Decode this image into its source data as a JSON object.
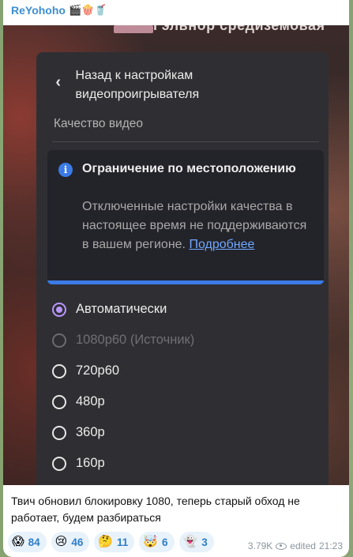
{
  "post": {
    "sender": "ReYohoho",
    "sender_emojis": "🎬🍿🥤",
    "caption": "Твич обновил блокировку 1080, теперь старый обход не работает, будем разбираться",
    "views": "3.79K",
    "edited_label": "edited",
    "time": "21:23"
  },
  "video": {
    "top_text": "Гэльнор средиземовая"
  },
  "settings": {
    "back_label": "Назад к настройкам видеопроигрывателя",
    "section_title": "Качество видео",
    "notice": {
      "icon": "info-icon",
      "title": "Ограничение по местоположению",
      "body": "Отключенные настройки качества в настоящее время не поддерживаются в вашем регионе.",
      "link": "Подробнее"
    },
    "options": [
      {
        "label": "Автоматически",
        "state": "selected"
      },
      {
        "label": "1080p60 (Источник)",
        "state": "disabled"
      },
      {
        "label": "720p60",
        "state": "available"
      },
      {
        "label": "480p",
        "state": "available"
      },
      {
        "label": "360p",
        "state": "available"
      },
      {
        "label": "160p",
        "state": "available"
      }
    ]
  },
  "reactions": [
    {
      "emoji": "😱",
      "count": "84"
    },
    {
      "emoji": "😢",
      "count": "46"
    },
    {
      "emoji": "🤔",
      "count": "11"
    },
    {
      "emoji": "🤯",
      "count": "6"
    },
    {
      "emoji": "👻",
      "count": "3"
    }
  ],
  "colors": {
    "accent": "#3c7be6",
    "selected_radio": "#b996ff",
    "link": "#6fa8ff",
    "sender": "#3d8fd1"
  }
}
